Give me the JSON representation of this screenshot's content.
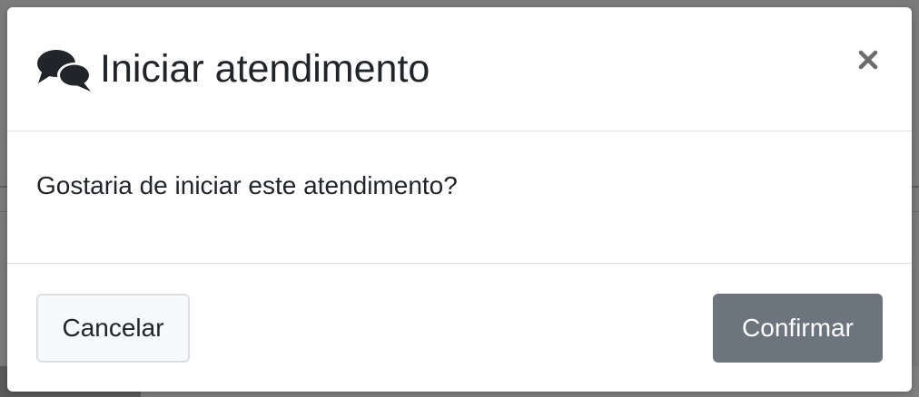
{
  "dialog": {
    "title": "Iniciar atendimento",
    "icon": "comments-icon",
    "close_label": "×",
    "message": "Gostaria de iniciar este atendimento?",
    "cancel_label": "Cancelar",
    "confirm_label": "Confirmar"
  },
  "colors": {
    "backdrop": "#7b7b7b",
    "modal_bg": "#ffffff",
    "text": "#212529",
    "divider": "#dee2e6",
    "cancel_bg": "#f8f9fa",
    "confirm_bg": "#6c757d",
    "close_icon": "#6c6c6c"
  }
}
